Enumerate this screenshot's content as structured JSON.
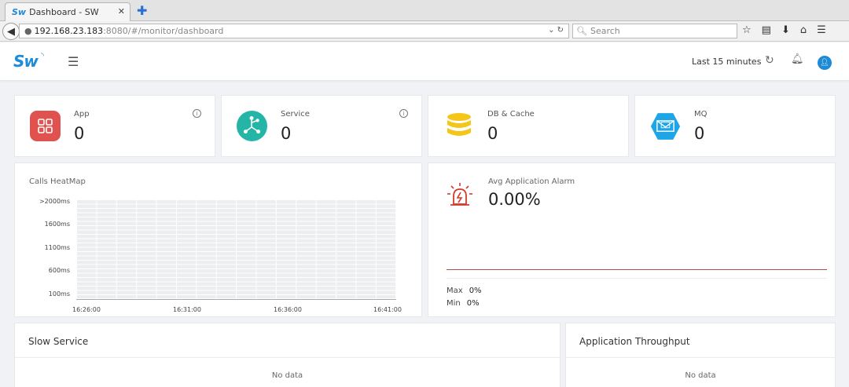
{
  "browser": {
    "tab_logo": "Sw",
    "tab_title": "Dashboard - SW",
    "url_host": "192.168.23.183",
    "url_rest": ":8080/#/monitor/dashboard",
    "search_placeholder": "Search"
  },
  "header": {
    "logo": "Sw",
    "time_range": "Last 15 minutes"
  },
  "stats": [
    {
      "label": "App",
      "value": "0",
      "icon": "app-grid-icon",
      "color": "#e0524f"
    },
    {
      "label": "Service",
      "value": "0",
      "icon": "service-share-icon",
      "color": "#25b5a6"
    },
    {
      "label": "DB & Cache",
      "value": "0",
      "icon": "database-icon",
      "color": "#f5c518"
    },
    {
      "label": "MQ",
      "value": "0",
      "icon": "mq-envelope-icon",
      "color": "#1ea5e6"
    }
  ],
  "heatmap": {
    "title": "Calls HeatMap",
    "y_labels": [
      ">2000ms",
      "1600ms",
      "1100ms",
      "600ms",
      "100ms"
    ],
    "x_labels": [
      "16:26:00",
      "16:31:00",
      "16:36:00",
      "16:41:00"
    ]
  },
  "alarm": {
    "title": "Avg Application Alarm",
    "value": "0.00%",
    "max_label": "Max",
    "max_value": "0%",
    "min_label": "Min",
    "min_value": "0%"
  },
  "slow_service": {
    "title": "Slow Service",
    "empty": "No data"
  },
  "throughput": {
    "title": "Application Throughput",
    "empty": "No data"
  }
}
